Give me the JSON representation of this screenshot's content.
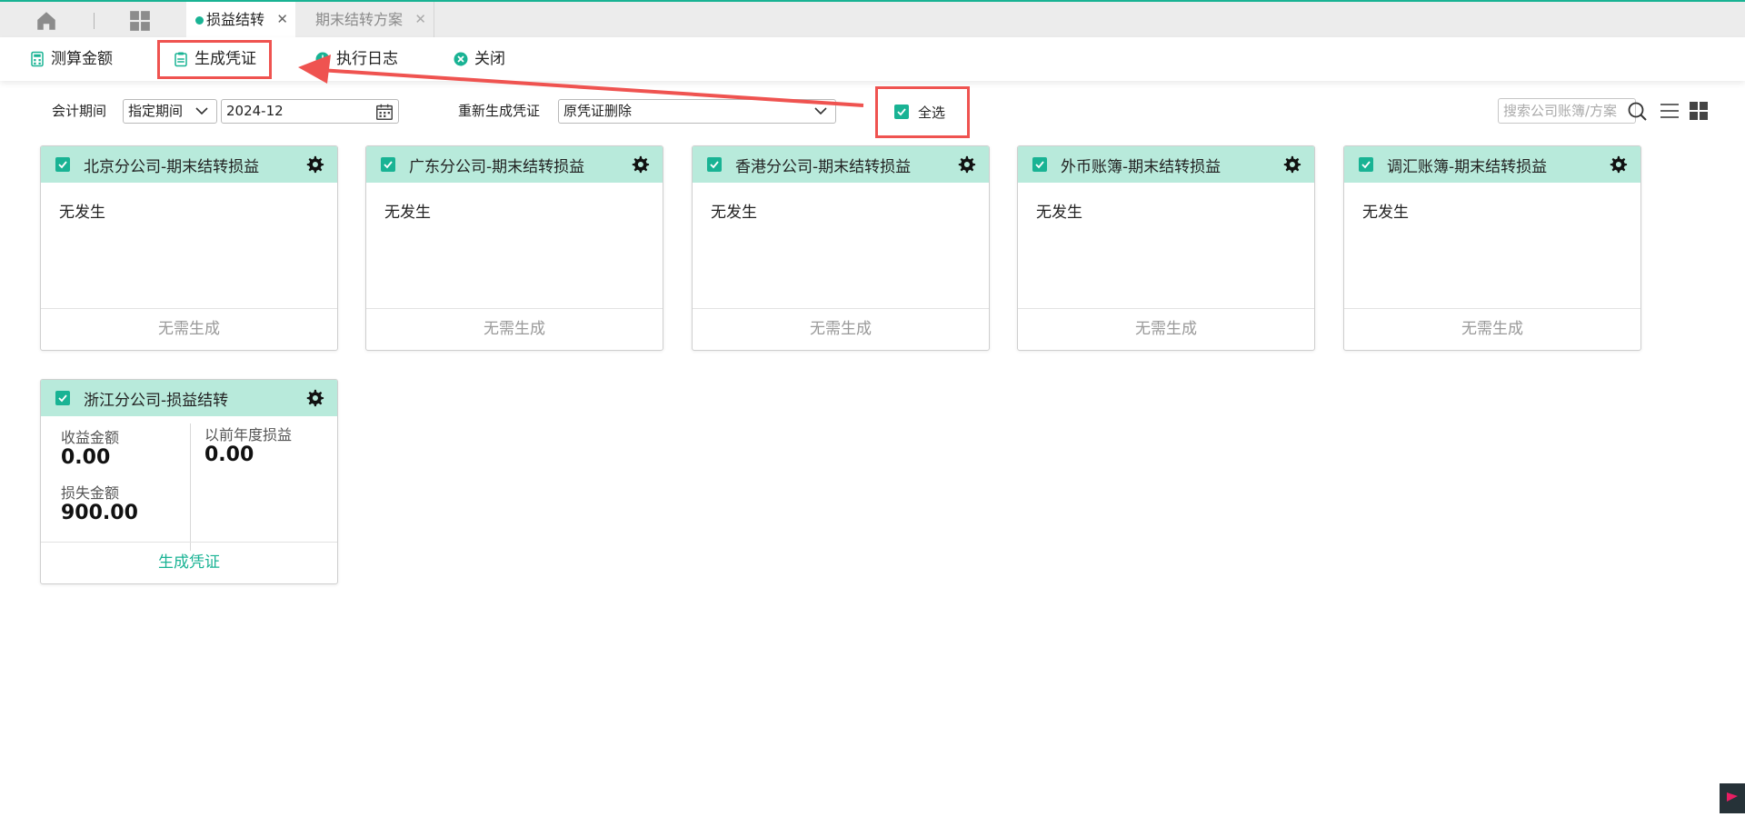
{
  "tabs": [
    {
      "label": "损益结转",
      "active": true
    },
    {
      "label": "期末结转方案",
      "active": false
    }
  ],
  "toolbar": {
    "calc_label": "测算金额",
    "generate_label": "生成凭证",
    "log_label": "执行日志",
    "close_label": "关闭"
  },
  "filters": {
    "period_label": "会计期间",
    "period_mode": "指定期间",
    "period_value": "2024-12",
    "regen_label": "重新生成凭证",
    "regen_value": "原凭证删除",
    "select_all_label": "全选",
    "search_placeholder": "搜索公司账簿/方案"
  },
  "cards": [
    {
      "title": "北京分公司-期末结转损益",
      "body": "无发生",
      "footer": "无需生成"
    },
    {
      "title": "广东分公司-期末结转损益",
      "body": "无发生",
      "footer": "无需生成"
    },
    {
      "title": "香港分公司-期末结转损益",
      "body": "无发生",
      "footer": "无需生成"
    },
    {
      "title": "外币账簿-期末结转损益",
      "body": "无发生",
      "footer": "无需生成"
    },
    {
      "title": "调汇账簿-期末结转损益",
      "body": "无发生",
      "footer": "无需生成"
    }
  ],
  "detail_card": {
    "title": "浙江分公司-损益结转",
    "income_label": "收益金额",
    "income_value": "0.00",
    "loss_label": "损失金额",
    "loss_value": "900.00",
    "prior_label": "以前年度损益",
    "prior_value": "0.00",
    "footer": "生成凭证"
  },
  "colors": {
    "accent": "#19b394",
    "card_header": "#b8eadb",
    "highlight": "#ef5350"
  }
}
